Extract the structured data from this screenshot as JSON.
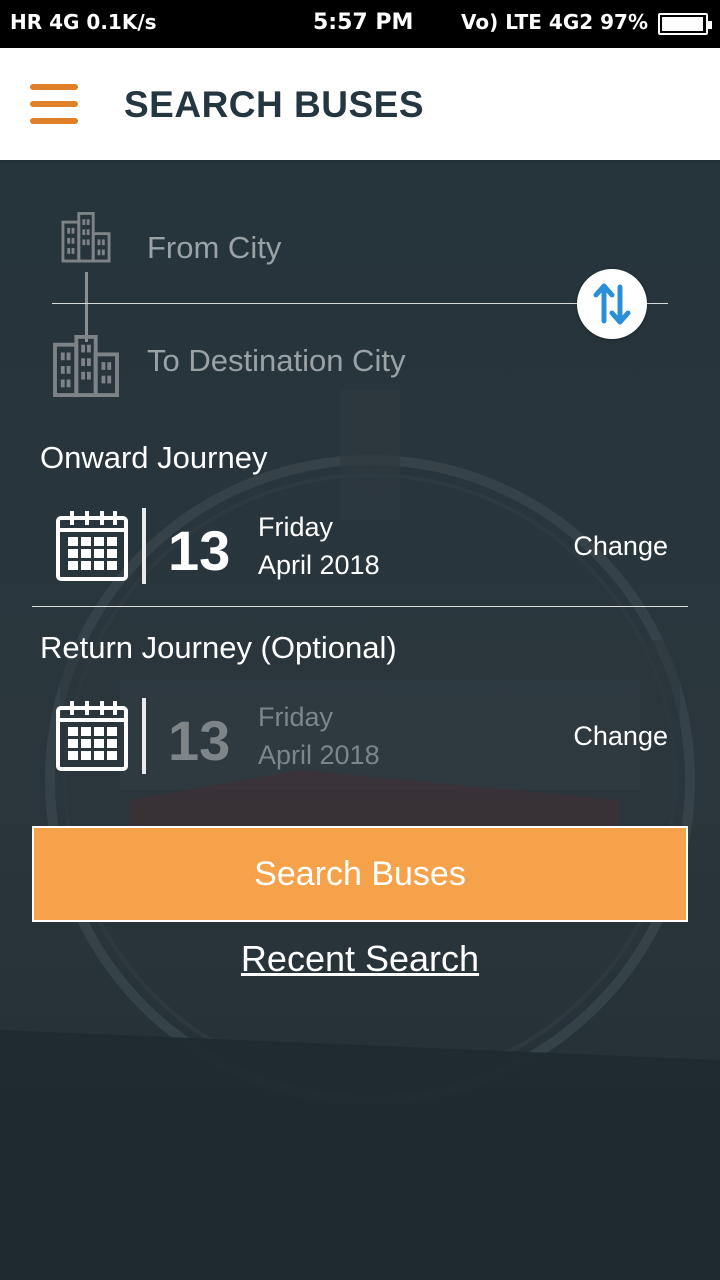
{
  "status_bar": {
    "left": "HR 4G 0.1K/s",
    "time": "5:57 PM",
    "right": "Vo) LTE 4G2 97%",
    "battery_percent": 97
  },
  "app_bar": {
    "title": "SEARCH BUSES",
    "menu_icon": "hamburger-menu-icon",
    "accent_color": "#e0812a"
  },
  "route": {
    "from_placeholder": "From City",
    "to_placeholder": "To Destination City",
    "swap_icon": "swap-vertical-icon",
    "swap_color": "#2b8fd6"
  },
  "onward": {
    "label": "Onward Journey",
    "day": "13",
    "weekday": "Friday",
    "month_year": "April 2018",
    "change_label": "Change"
  },
  "return_trip": {
    "label": "Return Journey (Optional)",
    "day": "13",
    "weekday": "Friday",
    "month_year": "April 2018",
    "change_label": "Change"
  },
  "actions": {
    "search_label": "Search Buses",
    "search_color": "#f6a24a",
    "recent_label": "Recent Search"
  }
}
